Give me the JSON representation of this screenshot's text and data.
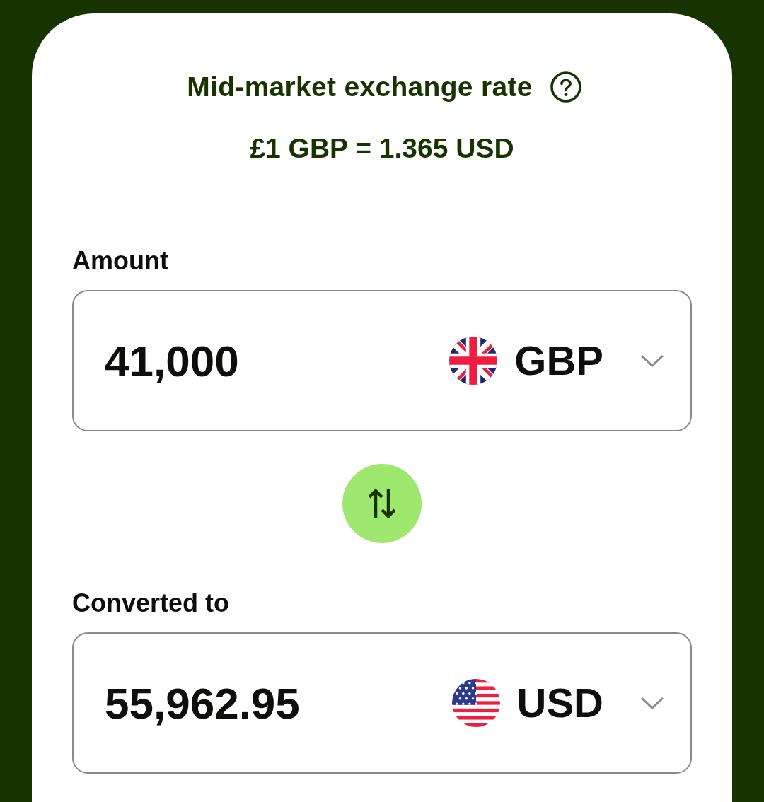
{
  "rate_info": {
    "title": "Mid-market exchange rate",
    "rate": "£1 GBP = 1.365 USD"
  },
  "converter": [
    {
      "label": "Amount",
      "value": "41,000",
      "currency": "GBP",
      "kind": "uk"
    },
    {
      "label": "Converted to",
      "value": "55,962.95",
      "currency": "USD",
      "kind": "us"
    }
  ]
}
